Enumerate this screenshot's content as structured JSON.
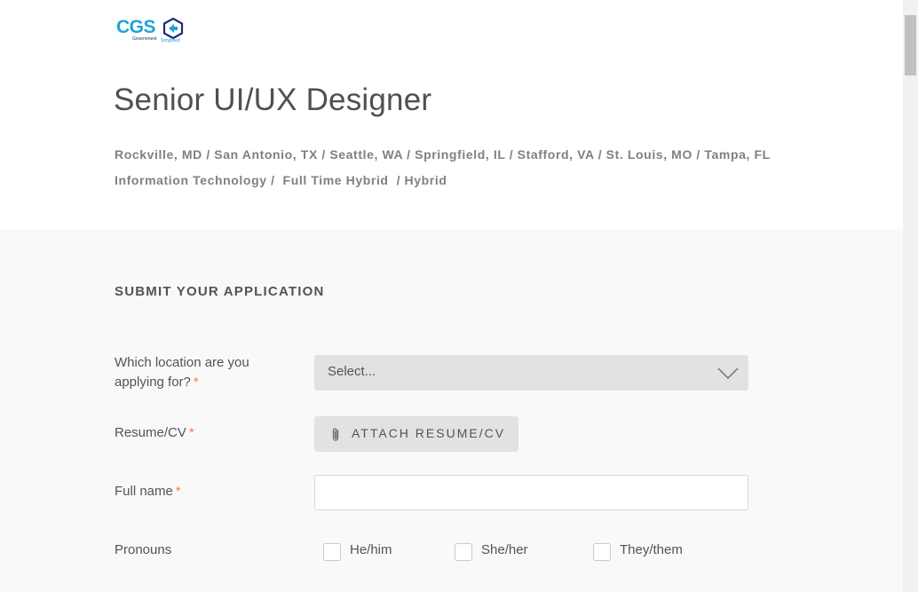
{
  "logo": {
    "brand": "CGS",
    "tagline_1": "Government",
    "tagline_2": "Simplified"
  },
  "job": {
    "title": "Senior UI/UX Designer",
    "locations": "Rockville, MD / San Antonio, TX / Seattle, WA / Springfield, IL / Stafford, VA / St. Louis, MO / Tampa, FL",
    "categories": "Information Technology /  Full Time Hybrid  / Hybrid"
  },
  "application": {
    "heading": "SUBMIT YOUR APPLICATION",
    "location_field": {
      "label_line1": "Which location are you",
      "label_line2": "applying for?",
      "required_mark": "*",
      "select_value": "Select..."
    },
    "resume_field": {
      "label": "Resume/CV",
      "required_mark": "*",
      "button_label": "ATTACH RESUME/CV"
    },
    "name_field": {
      "label": "Full name",
      "required_mark": "*",
      "value": ""
    },
    "pronouns_field": {
      "label": "Pronouns",
      "options": [
        {
          "label": "He/him",
          "checked": false
        },
        {
          "label": "She/her",
          "checked": false
        },
        {
          "label": "They/them",
          "checked": false
        }
      ]
    }
  },
  "colors": {
    "brand_blue": "#1fa3d8",
    "brand_navy": "#1c2a7a",
    "required": "#ff794f",
    "section_bg": "#f9f9f9",
    "control_bg": "#e2e2e2"
  },
  "icons": {
    "select_arrow": "chevron-down-icon",
    "attach": "paperclip-icon",
    "logo_mark": "hexagon-arrow-icon"
  }
}
